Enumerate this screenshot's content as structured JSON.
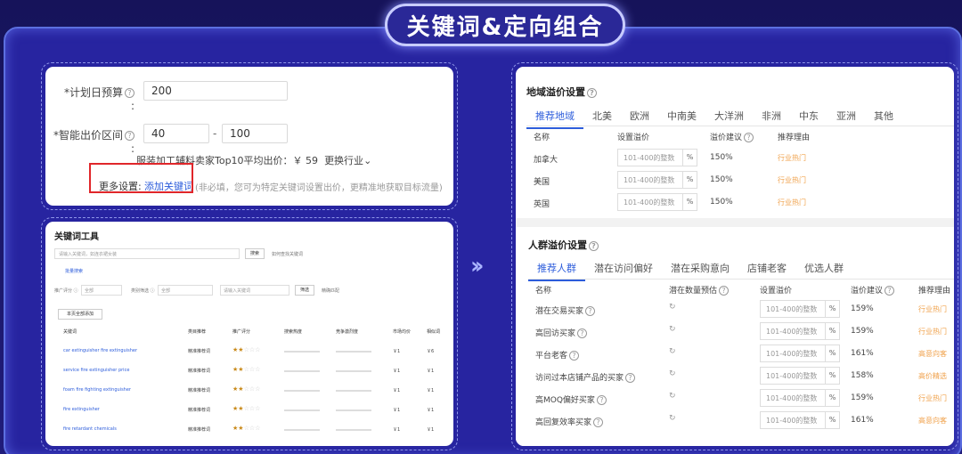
{
  "header": {
    "title": "关键词&定向组合"
  },
  "budget": {
    "daily_label": "*计划日预算",
    "daily_value": "200",
    "range_label": "*智能出价区间",
    "range_min": "40",
    "range_sep": "-",
    "range_max": "100",
    "colon": ":",
    "industry_text": "服装加工辅料卖家Top10平均出价：￥ 59",
    "change_industry": "更换行业",
    "more_label": "更多设置:",
    "add_keyword": "添加关键词",
    "hint": "(非必填，您可为特定关键词设置出价，更精准地获取目标流量)"
  },
  "keyword_tool": {
    "title": "关键词工具",
    "search_placeholder": "请输入关键词，如连衣裙女装",
    "search_btn": "搜索",
    "search_hint": "如何查找关键词",
    "batch_label": "批量搜索",
    "filter1_label": "推广评分 ⓘ",
    "filter1_value": "全部",
    "filter2_label": "类别筛选 ⓘ",
    "filter2_value": "全部",
    "filter3_placeholder": "请输入关键词",
    "filter_btn": "筛选",
    "filter_check": "精确匹配",
    "add_all": "本页全部添加",
    "columns": [
      "关键词",
      "类目推荐",
      "推广评分",
      "搜索热度",
      "竞争激烈度",
      "市场均价",
      "相似词"
    ],
    "rows": [
      {
        "kw": "car extinguisher fire extinguisher",
        "cat": "精准推荐词",
        "price": "￥1",
        "sim": "￥6"
      },
      {
        "kw": "service fire extinguisher price",
        "cat": "精准推荐词",
        "price": "￥1",
        "sim": "￥1"
      },
      {
        "kw": "foam fire fighting extinguisher",
        "cat": "精准推荐词",
        "price": "￥1",
        "sim": "￥1"
      },
      {
        "kw": "fire extinguisher",
        "cat": "精准推荐词",
        "price": "￥1",
        "sim": "￥1"
      },
      {
        "kw": "fire retardant chemicals",
        "cat": "精准推荐词",
        "price": "￥1",
        "sim": "￥1"
      }
    ]
  },
  "region": {
    "title": "地域溢价设置",
    "tabs": [
      "推荐地域",
      "北美",
      "欧洲",
      "中南美",
      "大洋洲",
      "非洲",
      "中东",
      "亚洲",
      "其他"
    ],
    "columns": [
      "名称",
      "设置溢价",
      "溢价建议",
      "推荐理由"
    ],
    "rows": [
      {
        "name": "加拿大",
        "placeholder": "101-400的整数",
        "suggest": "150%",
        "reason": "行业热门"
      },
      {
        "name": "美国",
        "placeholder": "101-400的整数",
        "suggest": "150%",
        "reason": "行业热门"
      },
      {
        "name": "英国",
        "placeholder": "101-400的整数",
        "suggest": "150%",
        "reason": "行业热门"
      }
    ],
    "pct": "%"
  },
  "crowd": {
    "title": "人群溢价设置",
    "tabs": [
      "推荐人群",
      "潜在访问偏好",
      "潜在采购意向",
      "店铺老客",
      "优选人群"
    ],
    "columns": [
      "名称",
      "潜在数量预估",
      "设置溢价",
      "溢价建议",
      "推荐理由"
    ],
    "rows": [
      {
        "name": "潜在交易买家",
        "placeholder": "101-400的整数",
        "suggest": "159%",
        "reason": "行业热门"
      },
      {
        "name": "高回访买家",
        "placeholder": "101-400的整数",
        "suggest": "159%",
        "reason": "行业热门"
      },
      {
        "name": "平台老客",
        "placeholder": "101-400的整数",
        "suggest": "161%",
        "reason": "高意向客"
      },
      {
        "name": "访问过本店铺产品的买家",
        "placeholder": "101-400的整数",
        "suggest": "158%",
        "reason": "高价精选"
      },
      {
        "name": "高MOQ偏好买家",
        "placeholder": "101-400的整数",
        "suggest": "159%",
        "reason": "行业热门"
      },
      {
        "name": "高回复效率买家",
        "placeholder": "101-400的整数",
        "suggest": "161%",
        "reason": "高意向客"
      }
    ],
    "pct": "%"
  },
  "colors": {
    "accent": "#2d5ddb",
    "orange": "#f0a24c",
    "highlight": "#e0262a",
    "frame": "#2724a0"
  }
}
